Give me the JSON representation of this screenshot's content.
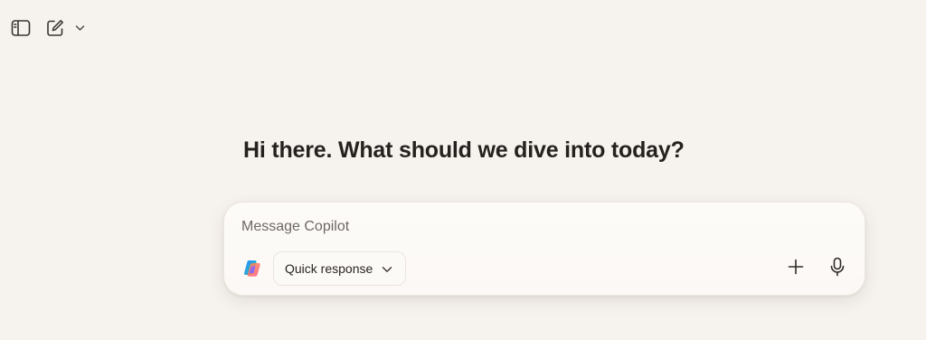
{
  "greeting": "Hi there. What should we dive into today?",
  "composer": {
    "placeholder": "Message Copilot",
    "mode_label": "Quick response"
  },
  "icons": {
    "sidebar_toggle": "sidebar-icon",
    "new_chat": "new-chat-icon",
    "new_chat_menu": "chevron-down-icon",
    "logo": "copilot-logo-icon",
    "mode_dropdown": "chevron-down-icon",
    "attach": "plus-icon",
    "voice": "microphone-icon"
  },
  "colors": {
    "background": "#f6f2ee",
    "card": "#fcfaf7",
    "text": "#25211e",
    "placeholder": "#6e6864"
  }
}
